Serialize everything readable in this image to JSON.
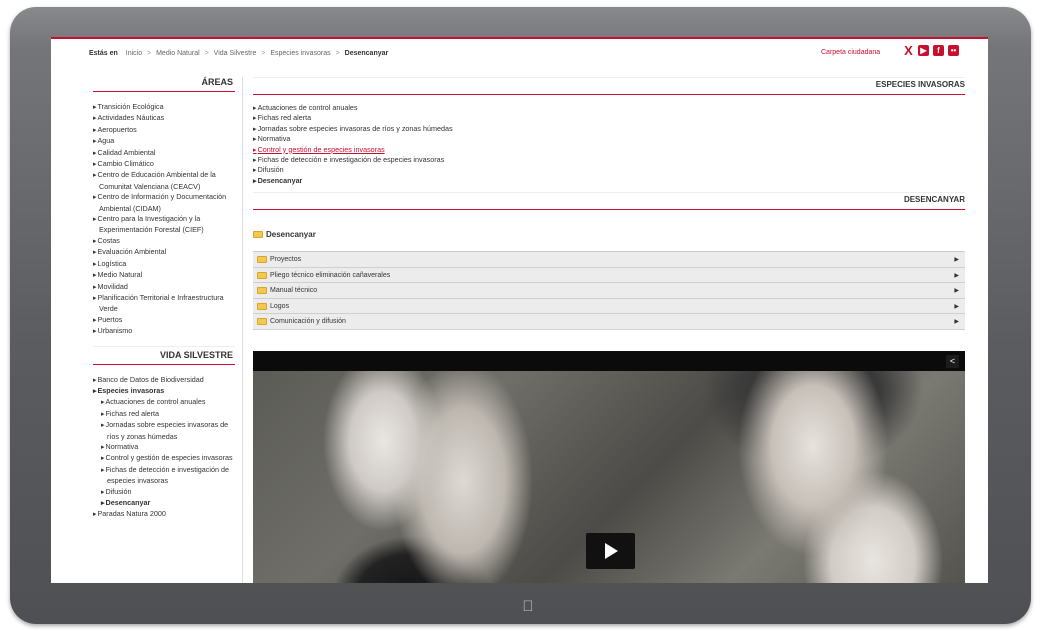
{
  "breadcrumb": {
    "prefix": "Estás en",
    "items": [
      "Inicio",
      "Medio Natural",
      "Vida Silvestre",
      "Especies invasoras"
    ],
    "current": "Desencanyar",
    "separator": ">"
  },
  "header": {
    "carpeta": "Carpeta ciudadana",
    "social": {
      "x": "X",
      "youtube": "▶",
      "facebook": "f",
      "flickr": "••"
    }
  },
  "sidebar": {
    "areas_title": "ÁREAS",
    "areas": [
      "Transición Ecológica",
      "Actividades Náuticas",
      "Aeropuertos",
      "Agua",
      "Calidad Ambiental",
      "Cambio Climático",
      "Centro de Educación Ambiental de la Comunitat Valenciana (CEACV)",
      "Centro de Información y Documentación Ambiental (CIDAM)",
      "Centro para la Investigación y la Experimentación Forestal (CIEF)",
      "Costas",
      "Evaluación Ambiental",
      "Logística",
      "Medio Natural",
      "Movilidad",
      "Planificación Territorial e Infraestructura Verde",
      "Puertos",
      "Urbanismo"
    ],
    "vida_title": "VIDA SILVESTRE",
    "vida": [
      "Banco de Datos de Biodiversidad",
      "Especies invasoras"
    ],
    "vida_sub": [
      "Actuaciones de control anuales",
      "Fichas red alerta",
      "Jornadas sobre especies invasoras de ríos y zonas húmedas",
      "Normativa",
      "Control y gestión de especies invasoras",
      "Fichas de detección e investigación de especies invasoras",
      "Difusión",
      "Desencanyar"
    ],
    "vida_after": "Paradas Natura 2000"
  },
  "main": {
    "section_title": "ESPECIES INVASORAS",
    "links": [
      "Actuaciones de control anuales",
      "Fichas red alerta",
      "Jornadas sobre especies invasoras de ríos y zonas húmedas",
      "Normativa",
      "Control y gestión de especies invasoras",
      "Fichas de detección e investigación de especies invasoras",
      "Difusión",
      "Desencanyar"
    ],
    "sub_title": "DESENCANYAR",
    "folder_title": "Desencanyar",
    "accordion": [
      "Proyectos",
      "Pliego técnico eliminación cañaverales",
      "Manual técnico",
      "Logos",
      "Comunicación y difusión"
    ]
  },
  "video": {
    "share_icon": "share-icon",
    "play_icon": "play-icon"
  },
  "colors": {
    "accent": "#c8102e",
    "bezel": "#5c5e61"
  }
}
